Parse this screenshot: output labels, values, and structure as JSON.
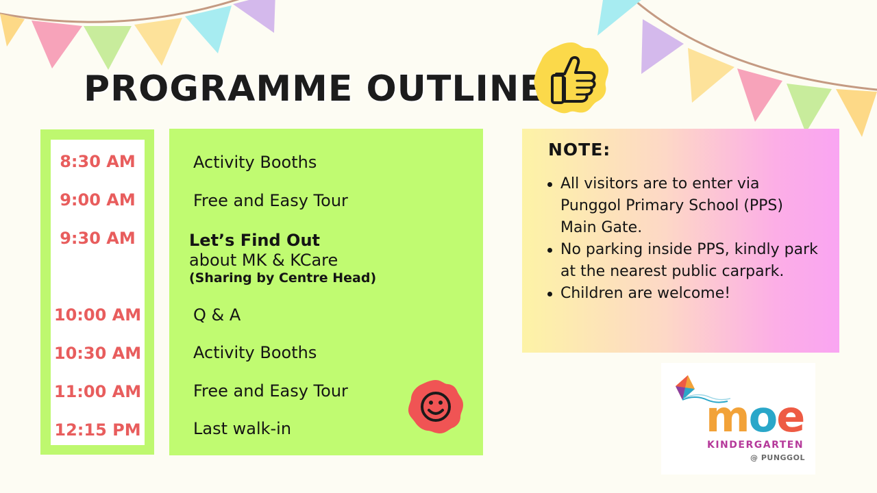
{
  "title": "PROGRAMME OUTLINE",
  "schedule": [
    {
      "time": "8:30 AM",
      "activity": "Activity Booths"
    },
    {
      "time": "9:00 AM",
      "activity": "Free and Easy Tour"
    },
    {
      "time": "9:30 AM",
      "activity_line1": "Let’s Find Out",
      "activity_line2": "about MK & KCare",
      "activity_line3": "(Sharing by Centre Head)"
    },
    {
      "time": "10:00 AM",
      "activity": "Q & A"
    },
    {
      "time": "10:30 AM",
      "activity": "Activity Booths"
    },
    {
      "time": "11:00 AM",
      "activity": "Free and Easy Tour"
    },
    {
      "time": "12:15 PM",
      "activity": "Last walk-in"
    }
  ],
  "note": {
    "title": "NOTE:",
    "items": [
      "All visitors are to enter via Punggol Primary School (PPS) Main Gate.",
      "No parking inside PPS, kindly park at the nearest public carpark.",
      "Children are welcome!"
    ]
  },
  "logo": {
    "moe": [
      "m",
      "o",
      "e"
    ],
    "kindergarten": "KINDERGARTEN",
    "location": "@ PUNGGOL"
  },
  "colors": {
    "time_text": "#e85d5d",
    "panel_green": "#c0fb71",
    "badge_yellow": "#fbd94a",
    "badge_red": "#f05454"
  },
  "icons": [
    "thumbs-up-icon",
    "smiley-icon",
    "kite-icon",
    "bunting-flags"
  ]
}
